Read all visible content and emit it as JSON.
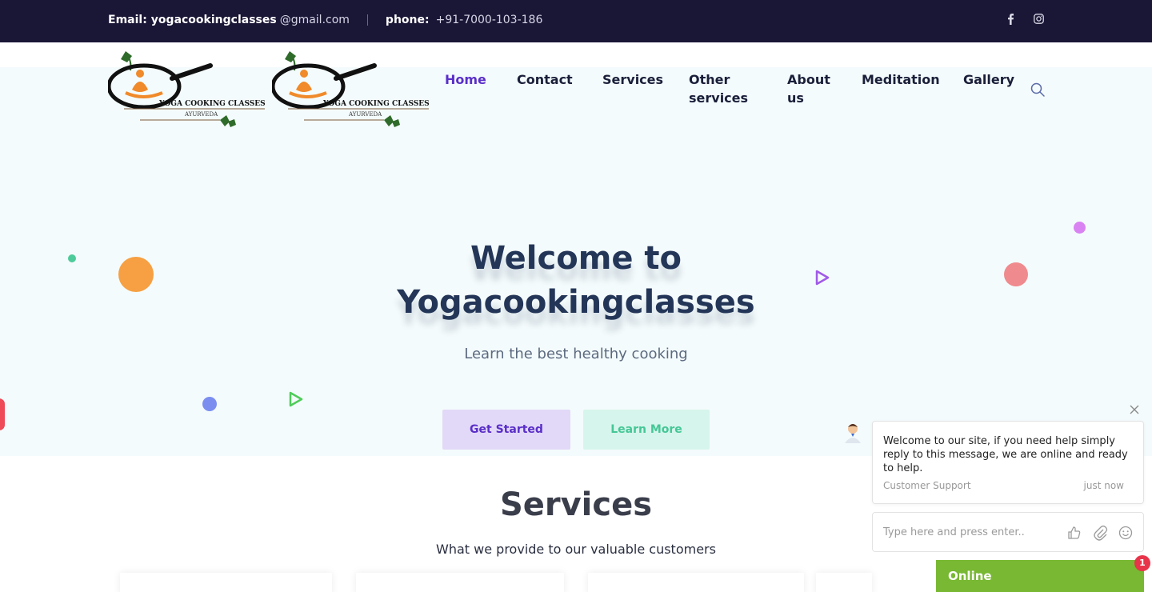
{
  "topbar": {
    "email_label": "Email:",
    "email_value_bold": "yogacookingclasses",
    "email_value_rest": "@gmail.com",
    "phone_label": "phone:",
    "phone_value": "+91-7000-103-186",
    "social_icons": [
      "facebook-icon",
      "instagram-icon"
    ]
  },
  "logo": {
    "text": "YOGA COOKING CLASSES",
    "subtext": "AYURVEDA"
  },
  "nav": {
    "items": [
      {
        "label": "Home",
        "active": true
      },
      {
        "label": "Contact",
        "active": false
      },
      {
        "label": "Services",
        "active": false
      },
      {
        "label": "Other",
        "label2": "services",
        "active": false
      },
      {
        "label": "About",
        "label2": "us",
        "active": false
      },
      {
        "label": "Meditation",
        "active": false
      },
      {
        "label": "Gallery",
        "active": false
      }
    ]
  },
  "hero": {
    "title_line1": "Welcome to",
    "title_line2": "Yogacookingclasses",
    "subtitle": "Learn the best healthy cooking",
    "primary_button": "Get Started",
    "secondary_button": "Learn More"
  },
  "services": {
    "title": "Services",
    "subtitle": "What we provide to our valuable customers"
  },
  "chat": {
    "message": "Welcome to our site, if you need help simply reply to this message, we are online and ready to help.",
    "agent": "Customer Support",
    "time": "just now",
    "input_placeholder": "Type here and press enter..",
    "status": "Online",
    "unread_count": "1"
  },
  "colors": {
    "topbar_bg": "#1a1636",
    "accent": "#5a2fc8",
    "hero_bg": "#f4fbfc",
    "chat_status": "#78b832"
  }
}
